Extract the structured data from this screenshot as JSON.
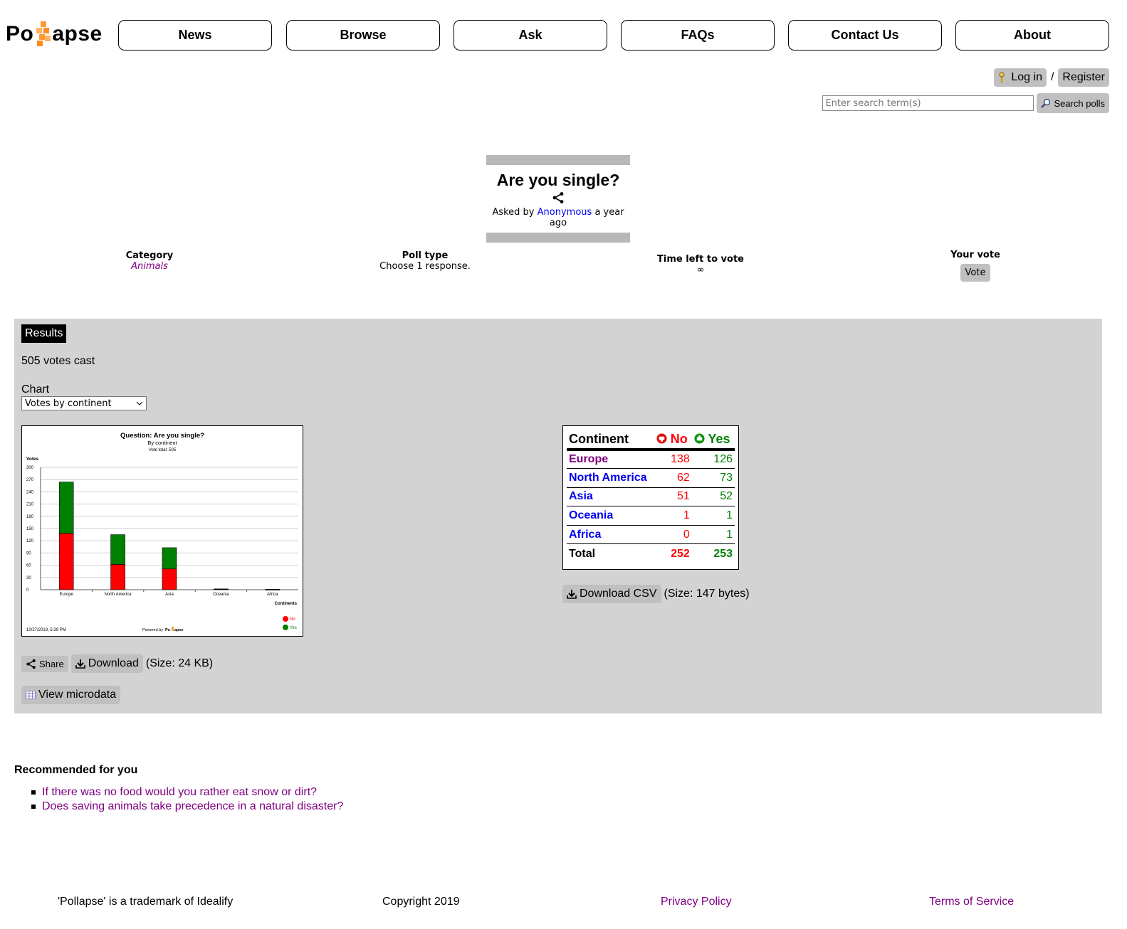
{
  "brand": {
    "logo_left": "Po",
    "logo_right": "apse",
    "accent": "#ff9933"
  },
  "nav": [
    {
      "id": "news",
      "label": "News"
    },
    {
      "id": "browse",
      "label": "Browse"
    },
    {
      "id": "ask",
      "label": "Ask"
    },
    {
      "id": "faqs",
      "label": "FAQs"
    },
    {
      "id": "contact",
      "label": "Contact Us"
    },
    {
      "id": "about",
      "label": "About"
    }
  ],
  "auth": {
    "login": "Log in",
    "separator": "/",
    "register": "Register"
  },
  "search": {
    "placeholder": "Enter search term(s)",
    "button": "Search polls"
  },
  "question": {
    "title": "Are you single?",
    "asked_by_prefix": "Asked by",
    "author": "Anonymous",
    "when": "a year ago"
  },
  "meta": {
    "category_label": "Category",
    "category_value": "Animals",
    "polltype_label": "Poll type",
    "polltype_value": "Choose 1 response.",
    "time_label": "Time left to vote",
    "time_value": "∞",
    "vote_label": "Your vote",
    "vote_button": "Vote"
  },
  "results": {
    "tab": "Results",
    "votes_cast": "505 votes cast",
    "chart_label": "Chart",
    "chart_select": "Votes by continent",
    "share": "Share",
    "download": "Download",
    "download_size": "(Size: 24 KB)",
    "microdata": "View microdata",
    "csv": "Download CSV",
    "csv_size": "(Size: 147 bytes)"
  },
  "chart_data": {
    "type": "bar",
    "title": "Question: Are you single?",
    "subtitle": "By continent",
    "subtitle2": "Vote total: 505",
    "ylabel": "Votes",
    "xlabel": "Continents",
    "ylim": [
      0,
      300
    ],
    "yticks": [
      0,
      30,
      60,
      90,
      120,
      150,
      180,
      210,
      240,
      270,
      300
    ],
    "categories": [
      "Europe",
      "North America",
      "Asia",
      "Oceania",
      "Africa"
    ],
    "stacked": true,
    "series": [
      {
        "name": "No",
        "color": "#ff0000",
        "values": [
          138,
          62,
          51,
          1,
          0
        ]
      },
      {
        "name": "Yes",
        "color": "#008000",
        "values": [
          126,
          73,
          52,
          1,
          1
        ]
      }
    ],
    "timestamp": "10/27/2019, 5:39 PM",
    "powered_by": "Powered by",
    "legend_position": "bottom-right",
    "grid": true
  },
  "table": {
    "header": {
      "continent": "Continent",
      "no": "No",
      "yes": "Yes"
    },
    "rows": [
      {
        "name": "Europe",
        "no": "138",
        "yes": "126",
        "color": "#800080"
      },
      {
        "name": "North America",
        "no": "62",
        "yes": "73",
        "color": "#0000ee"
      },
      {
        "name": "Asia",
        "no": "51",
        "yes": "52",
        "color": "#0000ee"
      },
      {
        "name": "Oceania",
        "no": "1",
        "yes": "1",
        "color": "#0000ee"
      },
      {
        "name": "Africa",
        "no": "0",
        "yes": "1",
        "color": "#0000ee"
      }
    ],
    "total": {
      "label": "Total",
      "no": "252",
      "yes": "253"
    }
  },
  "recommended": {
    "heading": "Recommended for you",
    "items": [
      "If there was no food would you rather eat snow or dirt?",
      "Does saving animals take precedence in a natural disaster?"
    ]
  },
  "footer": {
    "trademark": "'Pollapse' is a trademark of Idealify",
    "copyright": "Copyright 2019",
    "privacy": "Privacy Policy",
    "terms": "Terms of Service"
  }
}
